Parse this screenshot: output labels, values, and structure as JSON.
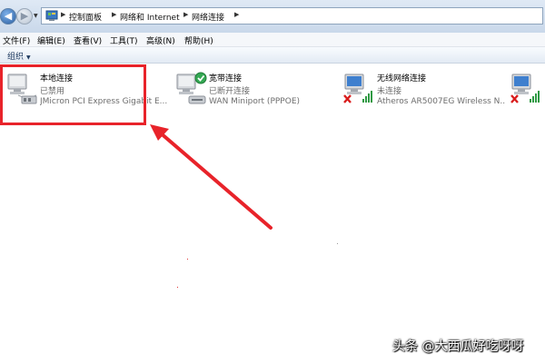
{
  "address_bar": {
    "breadcrumbs": [
      "控制面板",
      "网络和 Internet",
      "网络连接"
    ]
  },
  "menu": {
    "items": [
      "文件(F)",
      "编辑(E)",
      "查看(V)",
      "工具(T)",
      "高级(N)",
      "帮助(H)"
    ]
  },
  "toolbar": {
    "organize_label": "组织"
  },
  "connections": [
    {
      "name": "本地连接",
      "status": "已禁用",
      "device": "JMicron PCI Express Gigabit E...",
      "icon": "wired-network-icon",
      "overlay": "disabled"
    },
    {
      "name": "宽带连接",
      "status": "已断开连接",
      "device": "WAN Miniport (PPPOE)",
      "icon": "broadband-connection-icon",
      "overlay": "check"
    },
    {
      "name": "无线网络连接",
      "status": "未连接",
      "device": "Atheros AR5007EG Wireless N...",
      "icon": "wireless-network-icon",
      "overlay": "red-x"
    },
    {
      "name": "",
      "status": "",
      "device": "",
      "icon": "wireless-network-icon",
      "overlay": "red-x"
    }
  ],
  "annotation": {
    "color": "#e8232a"
  },
  "watermark": "头条 @大西瓜好吃呀呀"
}
